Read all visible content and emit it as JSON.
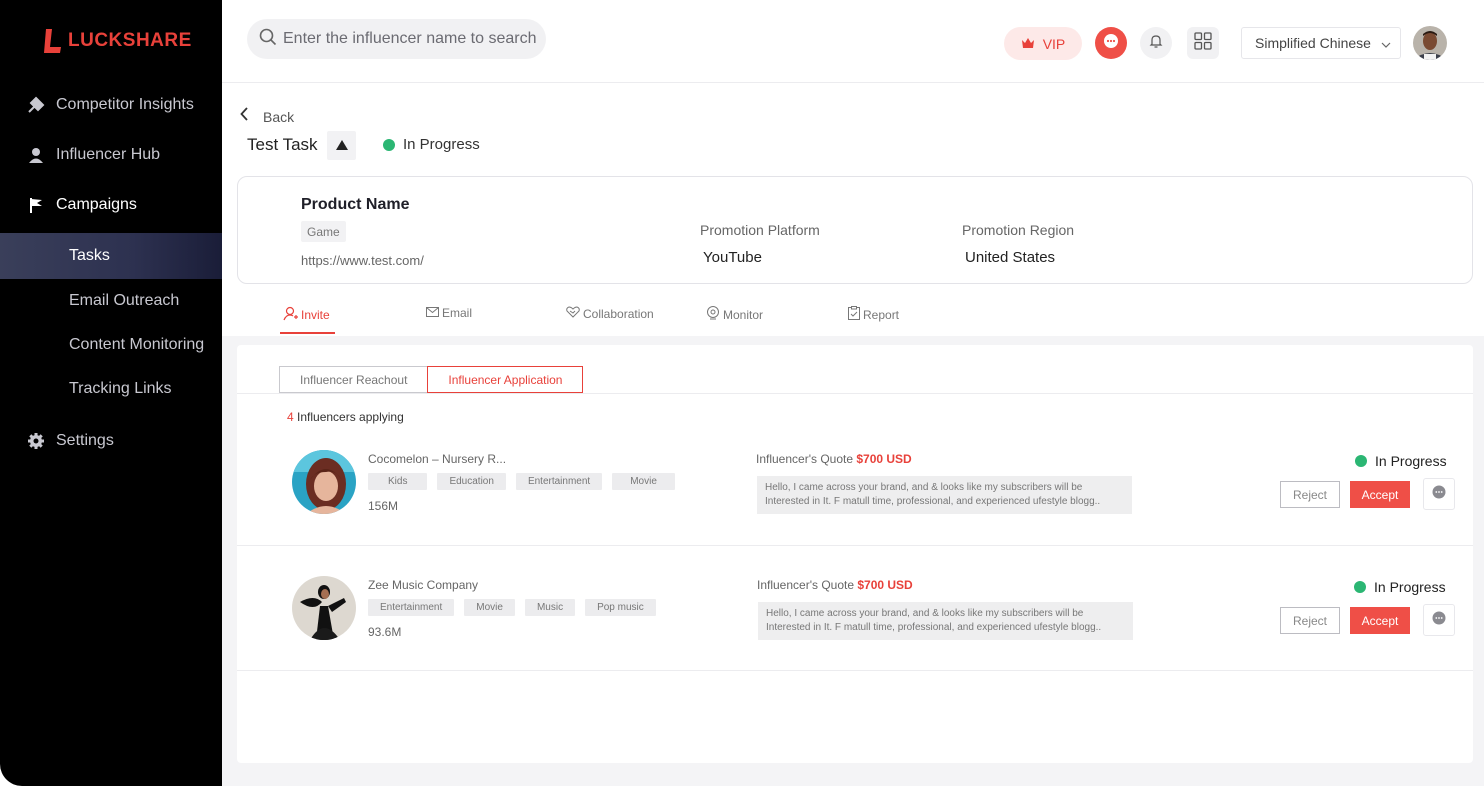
{
  "app": {
    "logo_text": "LUCKSHARE",
    "brand_color": "#e8413a"
  },
  "sidebar": {
    "items": [
      {
        "label": "Competitor Insights",
        "icon": "competitor-insights-icon"
      },
      {
        "label": "Influencer Hub",
        "icon": "influencer-hub-icon"
      },
      {
        "label": "Campaigns",
        "icon": "flag-icon"
      },
      {
        "label": "Settings",
        "icon": "gear-icon"
      }
    ],
    "sub_items": [
      {
        "label": "Tasks",
        "active": true
      },
      {
        "label": "Email Outreach"
      },
      {
        "label": "Content Monitoring"
      },
      {
        "label": "Tracking Links"
      }
    ]
  },
  "header": {
    "search_placeholder": "Enter the influencer name to search",
    "vip_label": "VIP",
    "language": "Simplified Chinese"
  },
  "page": {
    "back_label": "Back",
    "task_title": "Test Task",
    "status": "In Progress",
    "status_color": "#2bb673"
  },
  "product": {
    "name_label": "Product Name",
    "tag": "Game",
    "url": "https://www.test.com/",
    "platform_label": "Promotion Platform",
    "platform_value": "YouTube",
    "region_label": "Promotion Region",
    "region_value": "United States"
  },
  "tabs": [
    {
      "label": "Invite",
      "icon": "invite-user-icon",
      "active": true
    },
    {
      "label": "Email",
      "icon": "mail-icon"
    },
    {
      "label": "Collaboration",
      "icon": "handshake-icon"
    },
    {
      "label": "Monitor",
      "icon": "monitor-icon"
    },
    {
      "label": "Report",
      "icon": "clipboard-icon"
    }
  ],
  "subtabs": [
    {
      "label": "Influencer Reachout"
    },
    {
      "label": "Influencer Application",
      "active": true
    }
  ],
  "applications": {
    "count": "4",
    "count_suffix": " Influencers applying",
    "quote_label": "Influencer's Quote ",
    "reject_label": "Reject",
    "accept_label": "Accept",
    "rows": [
      {
        "name": "Cocomelon – Nursery R...",
        "tags": [
          "Kids",
          "Education",
          "Entertainment",
          "Movie"
        ],
        "followers": "156M",
        "price": "$700 USD",
        "message": "Hello, I came across your brand, and & looks like my subscribers will be Interested in It. F matull time, professional, and experienced ufestyle blogg..",
        "status": "In Progress"
      },
      {
        "name": "Zee Music Company",
        "tags": [
          "Entertainment",
          "Movie",
          "Music",
          "Pop music"
        ],
        "followers": "93.6M",
        "price": "$700 USD",
        "message": "Hello, I came across your brand, and & looks like my subscribers will be Interested in It. F matull time, professional, and experienced ufestyle blogg..",
        "status": "In Progress"
      }
    ]
  }
}
